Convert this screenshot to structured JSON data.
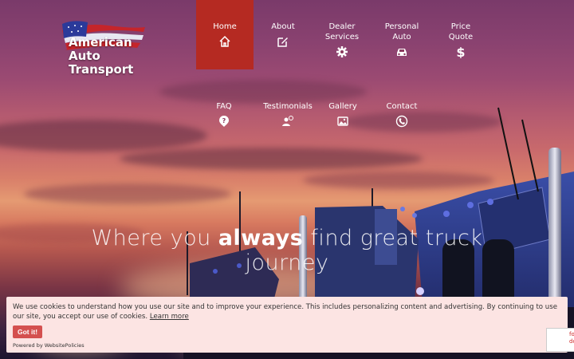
{
  "logo": {
    "lines": [
      "American",
      "Auto",
      "Transport"
    ]
  },
  "nav": {
    "home": {
      "label": "Home",
      "icon": "home-icon"
    },
    "about": {
      "label": "About",
      "icon": "edit-icon"
    },
    "dealer": {
      "label": "Dealer\nServices",
      "icon": "gear-icon"
    },
    "personal": {
      "label": "Personal\nAuto",
      "icon": "car-icon"
    },
    "price": {
      "label": "Price\nQuote",
      "icon": "dollar-icon"
    },
    "faq": {
      "label": "FAQ",
      "icon": "question-icon"
    },
    "testimonials": {
      "label": "Testimonials",
      "icon": "user-chat-icon"
    },
    "gallery": {
      "label": "Gallery",
      "icon": "images-icon"
    },
    "contact": {
      "label": "Contact",
      "icon": "phone-icon"
    }
  },
  "hero": {
    "headline_before": "Where you ",
    "headline_bold": "always",
    "headline_after": " find great truck journey"
  },
  "cookie": {
    "message": "We use cookies to understand how you use our site and to improve your experience. This includes personalizing content and advertising. By continuing to use our site, you accept our use of cookies.",
    "learn_more": "Learn more",
    "button": "Got it!",
    "powered": "Powered by WebsitePolicies"
  },
  "side_widget": {
    "line1": "fo",
    "line2": "do"
  },
  "colors": {
    "nav_active": "#b52a22",
    "cookie_bg": "#fce4e3",
    "cookie_button": "#d4504f"
  }
}
